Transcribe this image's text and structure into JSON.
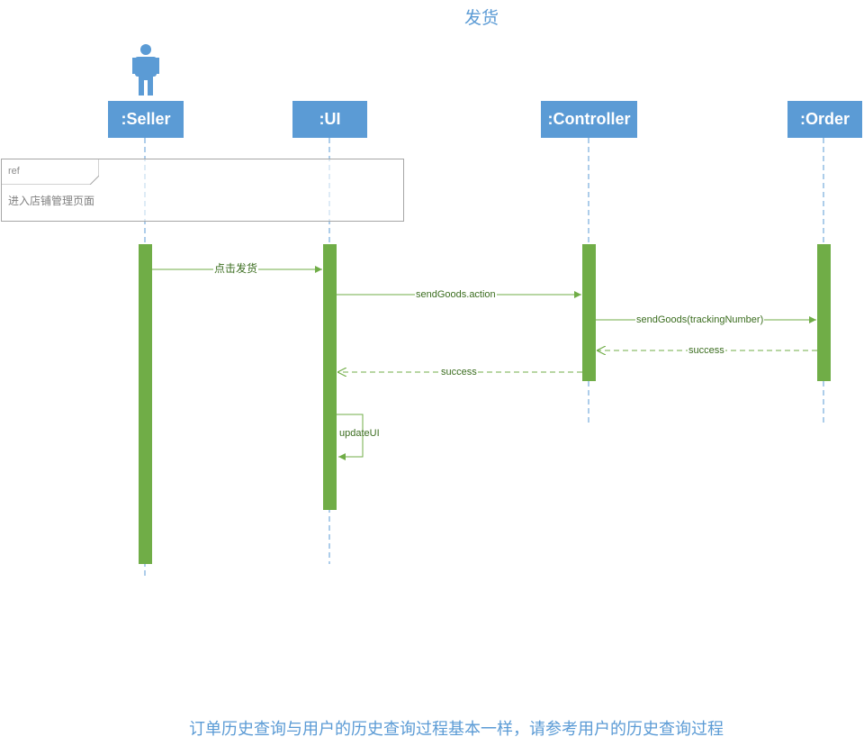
{
  "title": "发货",
  "footer_note": "订单历史查询与用户的历史查询过程基本一样，请参考用户的历史查询过程",
  "colors": {
    "title_blue": "#5b9bd5",
    "lifeline_head": "#5b9bd5",
    "activation_green": "#70ad47",
    "message_green": "#70ad47",
    "lifeline_dash": "#5b9bd5",
    "ref_border": "#a6a6a6"
  },
  "actor": {
    "icon": "person-icon"
  },
  "lifelines": [
    {
      "id": "seller",
      "label": ":Seller"
    },
    {
      "id": "ui",
      "label": ":UI"
    },
    {
      "id": "controller",
      "label": ":Controller"
    },
    {
      "id": "order",
      "label": ":Order"
    }
  ],
  "ref_fragment": {
    "tag": "ref",
    "text": "进入店铺管理页面"
  },
  "messages": [
    {
      "from": "seller",
      "to": "ui",
      "label": "点击发货",
      "kind": "sync"
    },
    {
      "from": "ui",
      "to": "controller",
      "label": "sendGoods.action",
      "kind": "sync"
    },
    {
      "from": "controller",
      "to": "order",
      "label": "sendGoods(trackingNumber)",
      "kind": "sync"
    },
    {
      "from": "order",
      "to": "controller",
      "label": "success",
      "kind": "return"
    },
    {
      "from": "controller",
      "to": "ui",
      "label": "success",
      "kind": "return"
    },
    {
      "from": "ui",
      "to": "ui",
      "label": "updateUI",
      "kind": "self"
    }
  ]
}
